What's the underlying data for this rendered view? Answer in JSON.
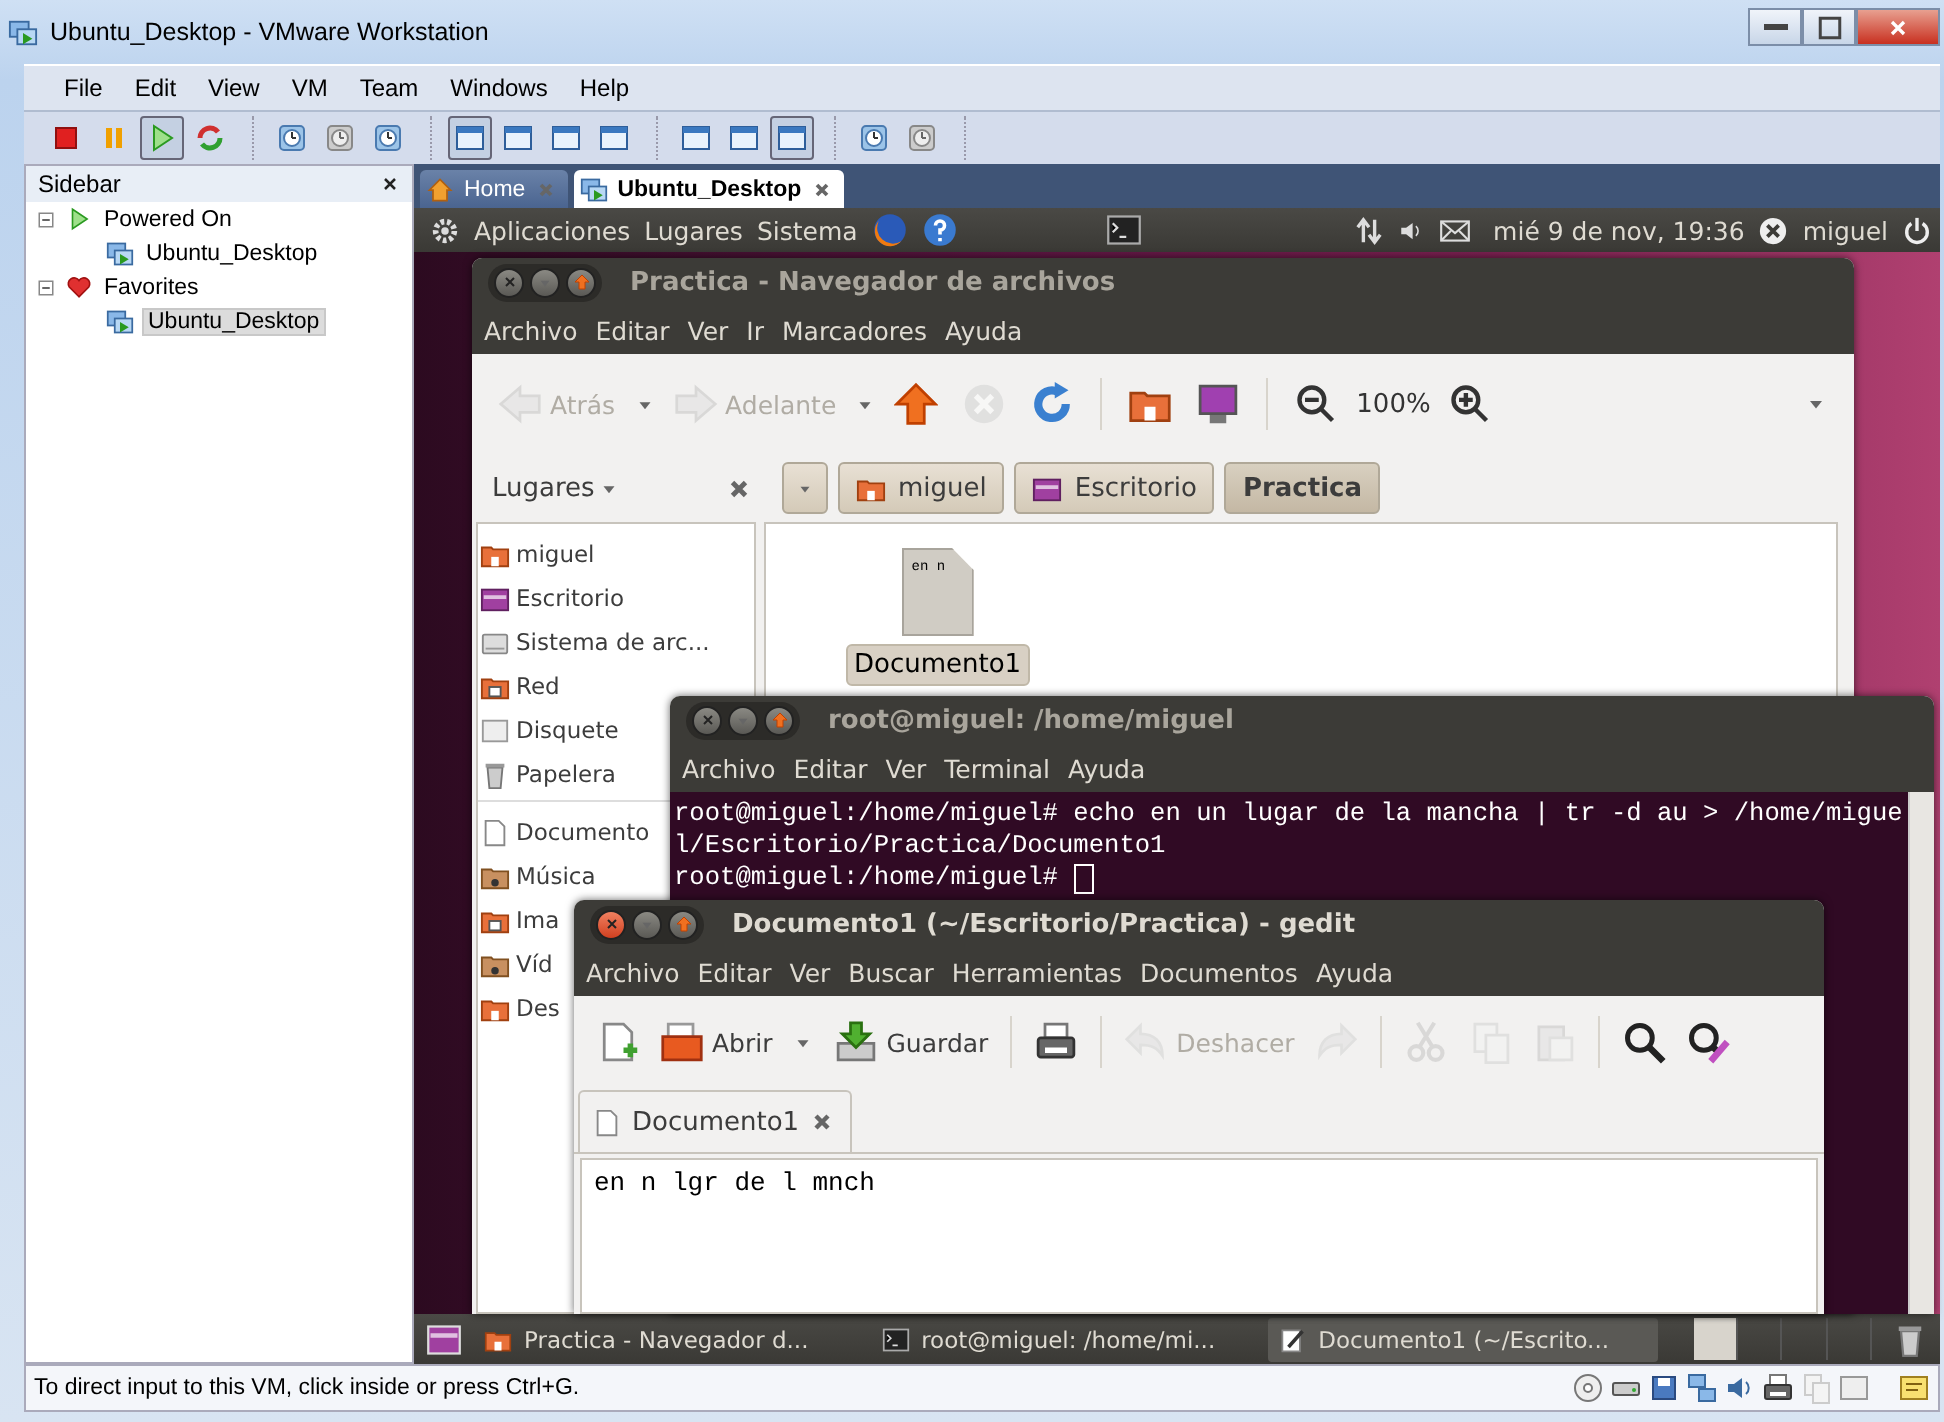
{
  "window": {
    "title": "Ubuntu_Desktop - VMware Workstation"
  },
  "menu": [
    "File",
    "Edit",
    "View",
    "VM",
    "Team",
    "Windows",
    "Help"
  ],
  "toolbar": [
    [
      {
        "kind": "stop",
        "selected": false
      },
      {
        "kind": "pause",
        "selected": false
      },
      {
        "kind": "play",
        "selected": true
      },
      {
        "kind": "reset",
        "selected": false
      }
    ],
    [
      {
        "kind": "snapshot",
        "selected": false
      },
      {
        "kind": "revert",
        "selected": false
      },
      {
        "kind": "manager",
        "selected": false
      }
    ],
    [
      {
        "kind": "console",
        "selected": true
      },
      {
        "kind": "fullscreen",
        "selected": false
      },
      {
        "kind": "quickswitch",
        "selected": false
      },
      {
        "kind": "unity",
        "selected": false
      }
    ],
    [
      {
        "kind": "summary",
        "selected": false
      },
      {
        "kind": "appliance",
        "selected": false
      },
      {
        "kind": "thumbnails",
        "selected": true
      }
    ],
    [
      {
        "kind": "capture",
        "selected": false
      },
      {
        "kind": "movie",
        "selected": false
      }
    ]
  ],
  "sidebar": {
    "title": "Sidebar",
    "tree": [
      {
        "label": "Powered On",
        "kind": "power",
        "expanded": true,
        "children": [
          {
            "label": "Ubuntu_Desktop",
            "selected": false
          }
        ]
      },
      {
        "label": "Favorites",
        "kind": "favorites",
        "expanded": true,
        "children": [
          {
            "label": "Ubuntu_Desktop",
            "selected": true
          }
        ]
      }
    ]
  },
  "tabs": [
    {
      "label": "Home",
      "kind": "home",
      "selected": false
    },
    {
      "label": "Ubuntu_Desktop",
      "kind": "vm",
      "selected": true
    }
  ],
  "ubuntu_panel": {
    "menus": [
      "Aplicaciones",
      "Lugares",
      "Sistema"
    ],
    "clock": "mié  9 de nov, 19:36",
    "user": "miguel"
  },
  "file_manager": {
    "title": "Practica - Navegador de archivos",
    "menu": [
      "Archivo",
      "Editar",
      "Ver",
      "Ir",
      "Marcadores",
      "Ayuda"
    ],
    "toolbar": [
      {
        "kind": "back",
        "label": "Atrás",
        "disabled": true
      },
      {
        "kind": "forward",
        "label": "Adelante",
        "disabled": true
      },
      {
        "kind": "up",
        "disabled": false
      },
      {
        "kind": "stop",
        "disabled": true
      },
      {
        "kind": "reload",
        "disabled": false
      },
      {
        "kind": "home",
        "disabled": false
      },
      {
        "kind": "computer",
        "disabled": false
      },
      {
        "kind": "zoom-out",
        "disabled": false
      },
      {
        "kind": "zoom-level",
        "label": "100%",
        "disabled": false
      },
      {
        "kind": "zoom-in",
        "disabled": false
      }
    ],
    "places_title": "Lugares",
    "breadcrumbs": [
      {
        "label": "miguel",
        "kind": "home",
        "selected": false
      },
      {
        "label": "Escritorio",
        "kind": "desktop",
        "selected": false
      },
      {
        "label": "Practica",
        "selected": true
      }
    ],
    "places": [
      {
        "label": "miguel",
        "kind": "home"
      },
      {
        "label": "Escritorio",
        "kind": "desktop"
      },
      {
        "label": "Sistema de arc...",
        "kind": "drive"
      },
      {
        "label": "Red",
        "kind": "network"
      },
      {
        "label": "Disquete",
        "kind": "floppy"
      },
      {
        "label": "Papelera",
        "kind": "trash"
      }
    ],
    "bookmarks": [
      {
        "label": "Documento",
        "kind": "documents"
      },
      {
        "label": "Música",
        "kind": "music"
      },
      {
        "label": "Ima",
        "kind": "pictures"
      },
      {
        "label": "Víd",
        "kind": "videos"
      },
      {
        "label": "Des",
        "kind": "downloads"
      }
    ],
    "files": [
      {
        "name": "Documento1",
        "preview": "en n",
        "selected": true
      }
    ]
  },
  "terminal": {
    "title": "root@miguel: /home/miguel",
    "menu": [
      "Archivo",
      "Editar",
      "Ver",
      "Terminal",
      "Ayuda"
    ],
    "lines": [
      "root@miguel:/home/miguel# echo en un lugar de la mancha | tr -d au > /home/migue",
      "l/Escritorio/Practica/Documento1",
      "root@miguel:/home/miguel# "
    ]
  },
  "gedit": {
    "title": "Documento1 (~/Escritorio/Practica) - gedit",
    "menu": [
      "Archivo",
      "Editar",
      "Ver",
      "Buscar",
      "Herramientas",
      "Documentos",
      "Ayuda"
    ],
    "toolbar": [
      {
        "kind": "new",
        "disabled": false
      },
      {
        "kind": "open",
        "label": "Abrir",
        "disabled": false
      },
      {
        "kind": "save",
        "label": "Guardar",
        "disabled": false
      },
      {
        "kind": "print",
        "disabled": false
      },
      {
        "kind": "undo",
        "label": "Deshacer",
        "disabled": true
      },
      {
        "kind": "redo",
        "disabled": true
      },
      {
        "kind": "cut",
        "disabled": true
      },
      {
        "kind": "copy",
        "disabled": true
      },
      {
        "kind": "paste",
        "disabled": true
      },
      {
        "kind": "find",
        "disabled": false
      },
      {
        "kind": "replace",
        "disabled": false
      }
    ],
    "tab": "Documento1",
    "text": "en n lgr de l mnch"
  },
  "taskbar": [
    {
      "label": "Practica - Navegador d...",
      "kind": "files",
      "selected": false
    },
    {
      "label": "root@miguel: /home/mi...",
      "kind": "terminal",
      "selected": false
    },
    {
      "label": "Documento1 (~/Escrito...",
      "kind": "editor",
      "selected": true
    }
  ],
  "status_bar": "To direct input to this VM, click inside or press Ctrl+G."
}
